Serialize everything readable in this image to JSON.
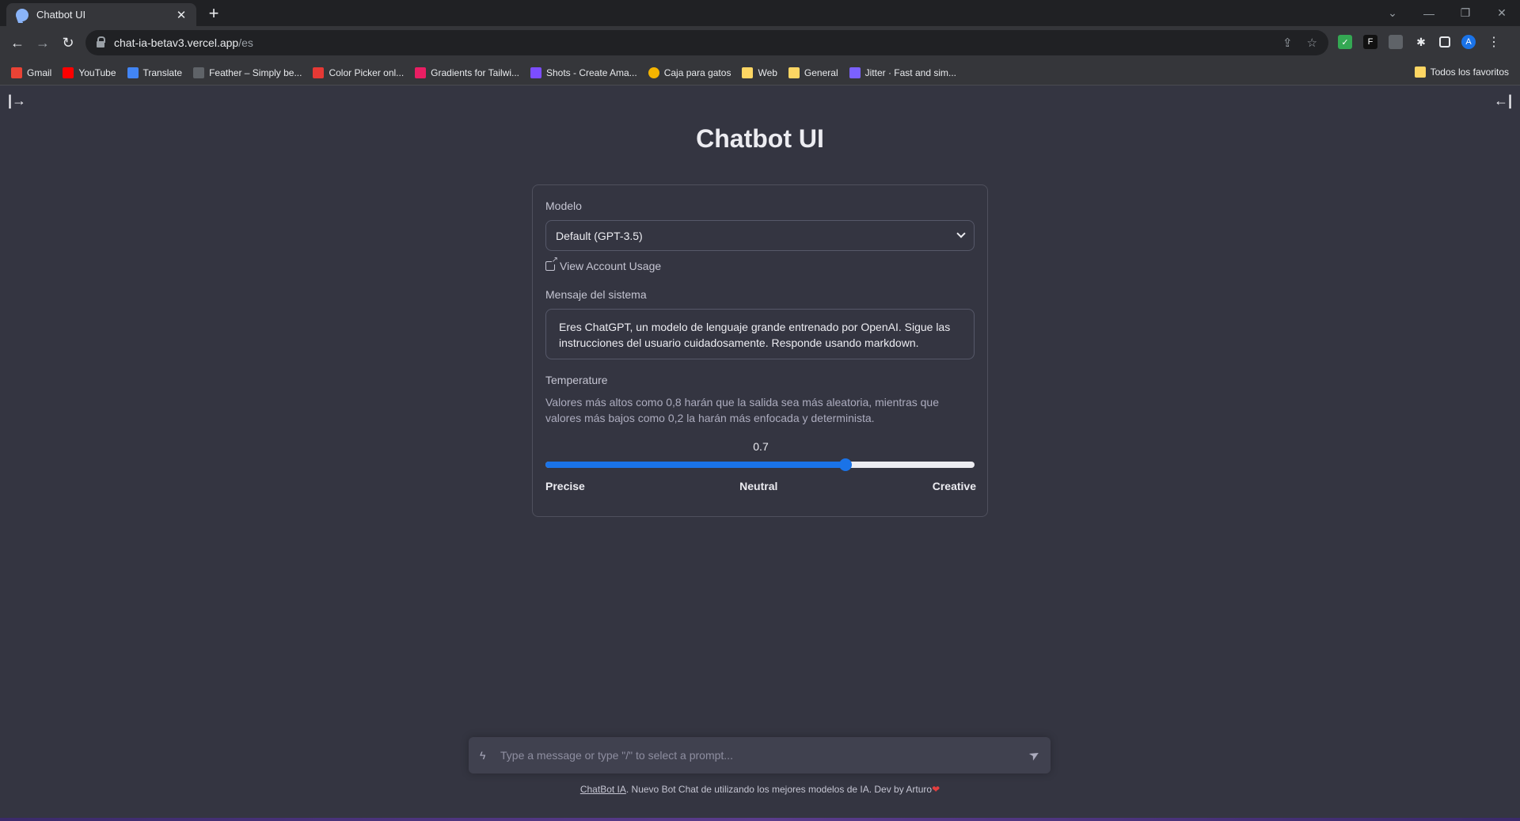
{
  "browser": {
    "tab_title": "Chatbot UI",
    "tab_close": "✕",
    "new_tab": "+",
    "url_host": "chat-ia-betav3.vercel.app",
    "url_path": "/es",
    "nav": {
      "back": "←",
      "forward": "→",
      "reload": "↻"
    },
    "window": {
      "chevron": "⌄",
      "minimize": "—",
      "restore": "❐",
      "close": "✕"
    },
    "bookmarks": [
      {
        "label": "Gmail",
        "color": "#ea4335"
      },
      {
        "label": "YouTube",
        "color": "#ff0000"
      },
      {
        "label": "Translate",
        "color": "#4285f4"
      },
      {
        "label": "Feather – Simply be...",
        "color": "#5f6368"
      },
      {
        "label": "Color Picker onl...",
        "color": "#e53935"
      },
      {
        "label": "Gradients for Tailwi...",
        "color": "#e91e63"
      },
      {
        "label": "Shots - Create Ama...",
        "color": "#7c4dff"
      },
      {
        "label": "Caja para gatos",
        "color": "#f4b400"
      },
      {
        "label": "Web",
        "color": "#fdd663"
      },
      {
        "label": "General",
        "color": "#fdd663"
      },
      {
        "label": "Jitter · Fast and sim...",
        "color": "#7b61ff"
      }
    ],
    "bookmarks_right": "Todos los favoritos"
  },
  "page": {
    "title": "Chatbot UI",
    "sidebar_open_icon": "|→",
    "sidebar_close_icon": "←|",
    "settings": {
      "model_label": "Modelo",
      "model_value": "Default (GPT-3.5)",
      "usage_link": "View Account Usage",
      "system_label": "Mensaje del sistema",
      "system_message": "Eres ChatGPT, un modelo de lenguaje grande entrenado por OpenAI. Sigue las instrucciones del usuario cuidadosamente. Responde usando markdown.",
      "temperature_label": "Temperature",
      "temperature_desc": "Valores más altos como 0,8 harán que la salida sea más aleatoria, mientras que valores más bajos como 0,2 la harán más enfocada y determinista.",
      "temperature_value": "0.7",
      "temperature_fraction": 0.7,
      "temperature_ticks": [
        "Precise",
        "Neutral",
        "Creative"
      ]
    },
    "chat_input": {
      "placeholder": "Type a message or type \"/\" to select a prompt...",
      "bolt_icon": "ϟ",
      "send_icon": "➤"
    },
    "footer": {
      "link": "ChatBot IA",
      "text": ". Nuevo Bot Chat de utilizando los mejores modelos de IA. Dev by Arturo",
      "heart": "❤"
    }
  }
}
